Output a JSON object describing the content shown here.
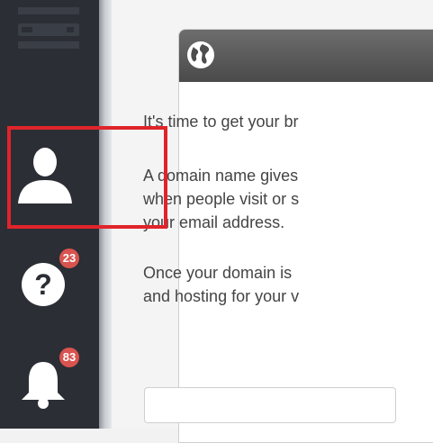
{
  "sidebar": {
    "icons": {
      "top": "server-icon",
      "user": "user-icon",
      "help": "question-icon",
      "bell": "bell-icon"
    },
    "help_badge": "23",
    "notifications_badge": "83"
  },
  "card": {
    "header_icon": "globe-icon",
    "paragraph1": "It's time to get your br",
    "paragraph2_line1": "A domain name gives",
    "paragraph2_line2": "when people visit or s",
    "paragraph2_line3": "your email address.",
    "paragraph3_line1": "Once your domain is",
    "paragraph3_line2": "and hosting for your v"
  },
  "colors": {
    "sidebar": "#2b2e35",
    "badge": "#d9534f",
    "highlight": "#e0242a",
    "card_header": "#555555"
  }
}
